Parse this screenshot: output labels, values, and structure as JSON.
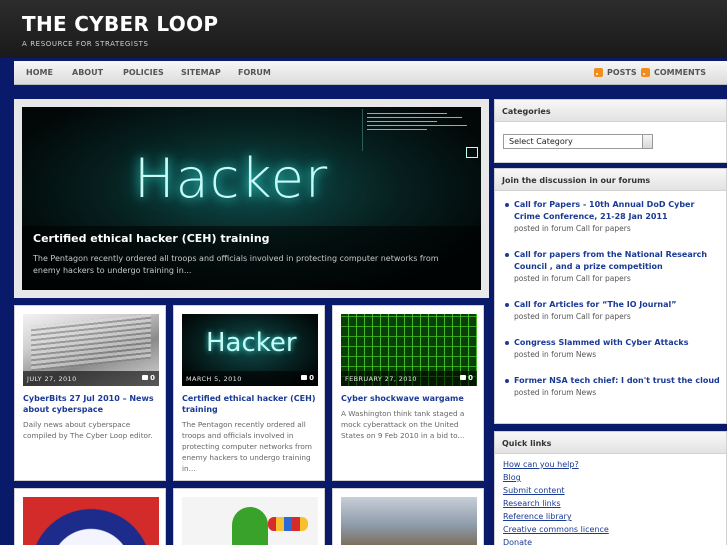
{
  "site": {
    "title": "THE CYBER LOOP",
    "tagline": "A RESOURCE FOR STRATEGISTS"
  },
  "nav": {
    "items": [
      "HOME",
      "ABOUT",
      "POLICIES",
      "SITEMAP",
      "FORUM"
    ],
    "posts_label": "POSTS",
    "comments_label": "COMMENTS"
  },
  "featured": {
    "image_text": "Hacker",
    "title": "Certified ethical hacker (CEH) training",
    "excerpt": "The Pentagon recently ordered all troops and officials involved in protecting computer networks from enemy hackers to undergo training in..."
  },
  "posts": [
    {
      "date": "JULY 27, 2010",
      "comments": "0",
      "title": "CyberBits 27 Jul 2010 – News about cyberspace",
      "excerpt": "Daily news about cyberspace compiled by The Cyber Loop editor."
    },
    {
      "date": "MARCH 5, 2010",
      "comments": "0",
      "image_text": "Hacker",
      "title": "Certified ethical hacker (CEH) training",
      "excerpt": "The Pentagon recently ordered all troops and officials involved in protecting computer networks from enemy hackers to undergo training in..."
    },
    {
      "date": "FEBRUARY 27, 2010",
      "comments": "0",
      "title": "Cyber shockwave wargame",
      "excerpt": "A Washington think tank staged a mock cyberattack on the United States on 9 Feb 2010 in a bid to..."
    }
  ],
  "sidebar": {
    "categories": {
      "title": "Categories",
      "selected": "Select Category"
    },
    "forums": {
      "title": "Join the discussion in our forums",
      "items": [
        {
          "link": "Call for Papers - 10th Annual DoD Cyber Crime Conference, 21-28 Jan 2011",
          "meta": "posted in forum Call for papers"
        },
        {
          "link": "Call for papers from the National Research Council , and a prize competition",
          "meta": "posted in forum Call for papers"
        },
        {
          "link": "Call for Articles for “The IO Journal”",
          "meta": "posted in forum Call for papers"
        },
        {
          "link": "Congress Slammed with Cyber Attacks",
          "meta": "posted in forum News"
        },
        {
          "link": "Former NSA tech chief: I don't trust the cloud",
          "meta": "posted in forum News"
        }
      ]
    },
    "quick_links": {
      "title": "Quick links",
      "items": [
        "How can you help?",
        "Blog",
        "Submit content",
        "Research links",
        "Reference library",
        "Creative commons licence",
        "Donate"
      ]
    }
  }
}
